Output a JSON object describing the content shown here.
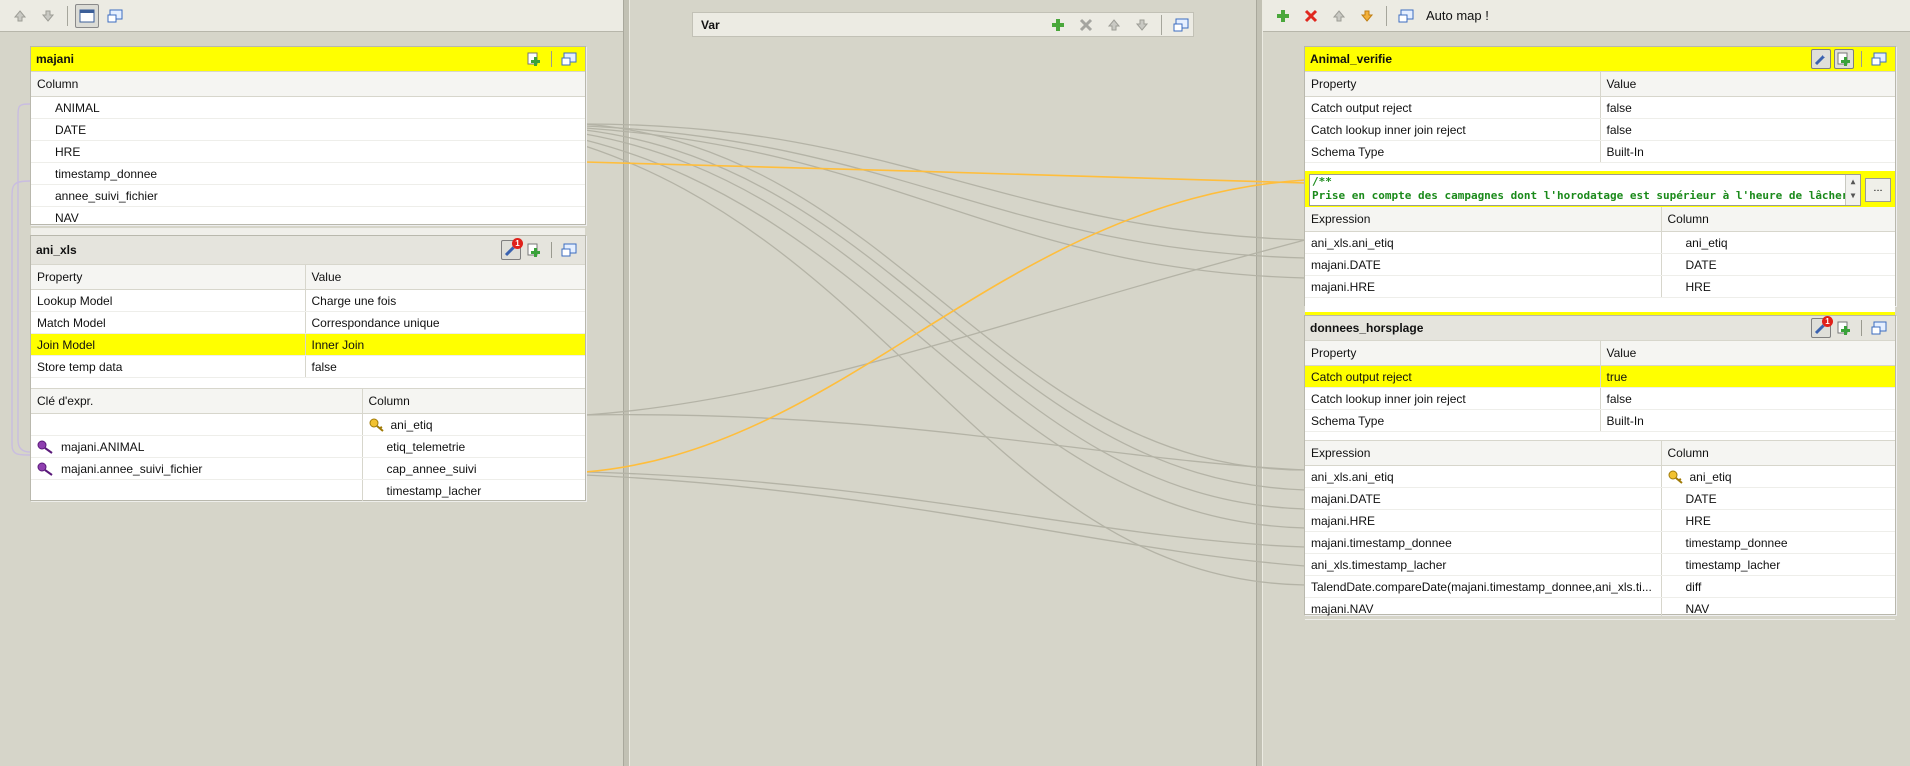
{
  "left_toolbar": {
    "icons": [
      "arrow-up-icon",
      "arrow-down-icon",
      "window-icon",
      "minimize-icon"
    ]
  },
  "var_panel": {
    "title": "Var"
  },
  "right_toolbar": {
    "auto_map_label": "Auto map !"
  },
  "majani": {
    "title": "majani",
    "column_header": "Column",
    "columns": [
      "ANIMAL",
      "DATE",
      "HRE",
      "timestamp_donnee",
      "annee_suivi_fichier",
      "NAV"
    ]
  },
  "ani_xls": {
    "title": "ani_xls",
    "badge": "1",
    "property_header": "Property",
    "value_header": "Value",
    "properties": [
      {
        "property": "Lookup Model",
        "value": "Charge une fois"
      },
      {
        "property": "Match Model",
        "value": "Correspondance unique"
      },
      {
        "property": "Join Model",
        "value": "Inner Join"
      },
      {
        "property": "Store temp data",
        "value": "false"
      }
    ],
    "key_header": "Clé d'expr.",
    "column_header": "Column",
    "rows": [
      {
        "expr": "",
        "column": "ani_etiq"
      },
      {
        "expr": "majani.ANIMAL",
        "column": "etiq_telemetrie"
      },
      {
        "expr": "majani.annee_suivi_fichier",
        "column": "cap_annee_suivi"
      },
      {
        "expr": "",
        "column": "timestamp_lacher"
      }
    ]
  },
  "animal_verifie": {
    "title": "Animal_verifie",
    "property_header": "Property",
    "value_header": "Value",
    "properties": [
      {
        "property": "Catch output reject",
        "value": "false"
      },
      {
        "property": "Catch lookup inner join reject",
        "value": "false"
      },
      {
        "property": "Schema Type",
        "value": "Built-In"
      }
    ],
    "filter_line1": "/**",
    "filter_line2": "Prise en compte des campagnes dont l'horodatage est supérieur à l'heure de lâcher le jour de la ca",
    "filter_button": "...",
    "expr_header": "Expression",
    "column_header": "Column",
    "rows": [
      {
        "expr": "ani_xls.ani_etiq",
        "column": "ani_etiq"
      },
      {
        "expr": "majani.DATE",
        "column": "DATE"
      },
      {
        "expr": "majani.HRE",
        "column": "HRE"
      }
    ]
  },
  "donnees_horsplage": {
    "title": "donnees_horsplage",
    "badge": "1",
    "property_header": "Property",
    "value_header": "Value",
    "properties": [
      {
        "property": "Catch output reject",
        "value": "true"
      },
      {
        "property": "Catch lookup inner join reject",
        "value": "false"
      },
      {
        "property": "Schema Type",
        "value": "Built-In"
      }
    ],
    "expr_header": "Expression",
    "column_header": "Column",
    "rows": [
      {
        "expr": "ani_xls.ani_etiq",
        "column": "ani_etiq"
      },
      {
        "expr": "majani.DATE",
        "column": "DATE"
      },
      {
        "expr": "majani.HRE",
        "column": "HRE"
      },
      {
        "expr": "majani.timestamp_donnee",
        "column": "timestamp_donnee"
      },
      {
        "expr": "ani_xls.timestamp_lacher",
        "column": "timestamp_lacher"
      },
      {
        "expr": "TalendDate.compareDate(majani.timestamp_donnee,ani_xls.ti...",
        "column": "diff"
      },
      {
        "expr": "majani.NAV",
        "column": "NAV"
      }
    ]
  },
  "colors": {
    "highlight": "#ffff00",
    "link_grey": "#b4b3a6",
    "link_orange": "#ffbe3c",
    "filter_text": "#1a8a1a"
  }
}
